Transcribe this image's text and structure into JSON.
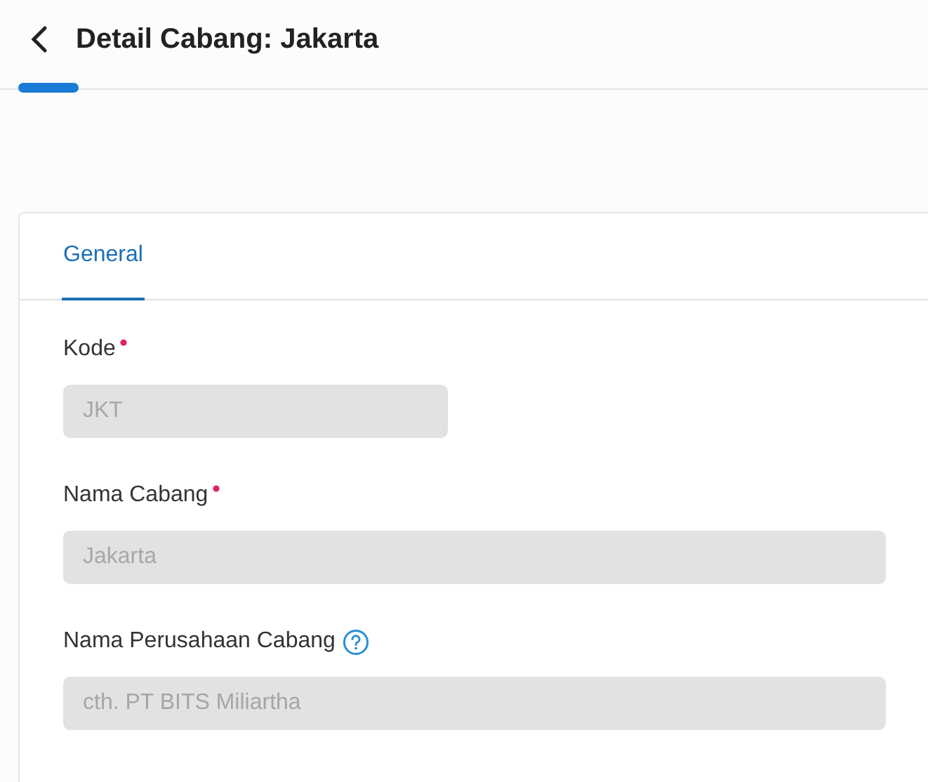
{
  "header": {
    "title": "Detail Cabang: Jakarta"
  },
  "tabs": [
    {
      "label": "General",
      "selected": true
    }
  ],
  "fields": [
    {
      "kind": "short",
      "label": "Kode",
      "required": true,
      "help": false,
      "disabled": true,
      "value": "JKT"
    },
    {
      "kind": "wide",
      "label": "Nama Cabang",
      "required": true,
      "help": false,
      "disabled": true,
      "value": "Jakarta"
    },
    {
      "kind": "wide",
      "label": "Nama Perusahaan Cabang",
      "required": false,
      "help": true,
      "disabled": true,
      "placeholder": "cth. PT BITS Miliartha"
    }
  ]
}
